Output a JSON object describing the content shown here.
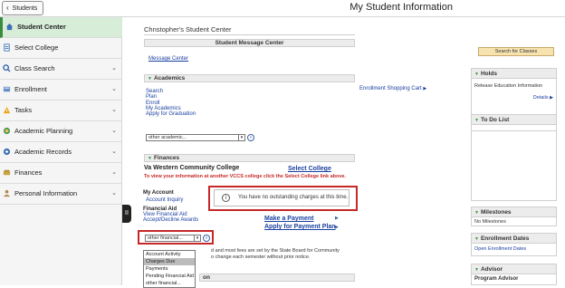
{
  "header": {
    "back_label": "Students",
    "title": "My Student Information"
  },
  "sidebar": {
    "items": [
      {
        "label": "Student Center",
        "icon": "home-icon",
        "active": true
      },
      {
        "label": "Select College",
        "icon": "document-icon"
      },
      {
        "label": "Class Search",
        "icon": "search-icon"
      },
      {
        "label": "Enrollment",
        "icon": "enrollment-icon"
      },
      {
        "label": "Tasks",
        "icon": "warning-icon"
      },
      {
        "label": "Academic Planning",
        "icon": "planning-icon"
      },
      {
        "label": "Academic Records",
        "icon": "records-icon"
      },
      {
        "label": "Finances",
        "icon": "finances-icon"
      },
      {
        "label": "Personal Information",
        "icon": "person-icon"
      }
    ]
  },
  "main": {
    "student_center_title": "Chnstopher's Student Center",
    "message_center": {
      "header": "Student Message Center",
      "link": "Message Center"
    },
    "academics": {
      "header": "Academics",
      "links": [
        "Search",
        "Plan",
        "Enroll",
        "My Academics",
        "Apply for Graduation"
      ],
      "cart_link": "Enrollment Shopping Cart",
      "select_value": "other academic..."
    },
    "finances": {
      "header": "Finances",
      "college_name": "Va Western Community College",
      "select_college": "Select College",
      "notice": "To view your information at another VCCS college click the Select College link above.",
      "my_account_heading": "My Account",
      "account_inquiry": "Account Inquiry",
      "financial_aid_heading": "Financial Aid",
      "view_financial_aid": "View Financial Aid",
      "accept_decline": "Accept/Decline Awards",
      "no_charges": "You have no outstanding charges at this time.",
      "make_payment": "Make a Payment",
      "apply_payment_plan": "Apply for Payment Plan",
      "tuition_note_1": "d and most fees are set by the State Board for Community",
      "tuition_note_2": "o change each semester without prior notice.",
      "select_value": "other financial...",
      "dropdown_options": [
        "Account Activity",
        "Charges Due",
        "Payments",
        "Pending Financial Aid",
        "other financial..."
      ],
      "dropdown_selected": "Charges Due",
      "next_section_partial": "on"
    }
  },
  "right": {
    "search_button": "Search for Classes",
    "holds": {
      "header": "Holds",
      "body": "Release Education Information",
      "details": "Details"
    },
    "todo": {
      "header": "To Do List"
    },
    "milestones": {
      "header": "Milestones",
      "body": "No Milestones"
    },
    "enrollment_dates": {
      "header": "Enrollment Dates",
      "link": "Open Enrollment Dates"
    },
    "advisor": {
      "header": "Advisor",
      "body": "Program Advisor"
    }
  },
  "colors": {
    "accent_green": "#3b8a3e",
    "highlight_red": "#c62828",
    "link_blue": "#1a3fa0"
  }
}
